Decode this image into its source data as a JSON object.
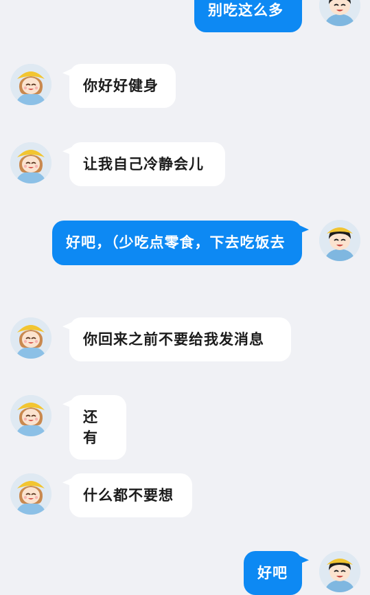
{
  "messages": [
    {
      "side": "out",
      "text": "别吃这么多"
    },
    {
      "side": "in",
      "text": "你好好健身"
    },
    {
      "side": "in",
      "text": "让我自己冷静会儿"
    },
    {
      "side": "out",
      "text": "好吧，（少吃点零食，下去吃饭去"
    },
    {
      "side": "in",
      "text": "你回来之前不要给我发消息"
    },
    {
      "side": "in",
      "text": "还有"
    },
    {
      "side": "in",
      "text": "什么都不要想"
    },
    {
      "side": "out",
      "text": "好吧"
    }
  ],
  "colors": {
    "background": "#f0f1f5",
    "incoming_bubble": "#ffffff",
    "outgoing_bubble": "#0d89f3",
    "outgoing_text": "#ffffff",
    "incoming_text": "#1b1b1b"
  },
  "avatars": {
    "incoming": "girl-yellow-hat-avatar-icon",
    "outgoing": "boy-yellow-hat-avatar-icon"
  }
}
